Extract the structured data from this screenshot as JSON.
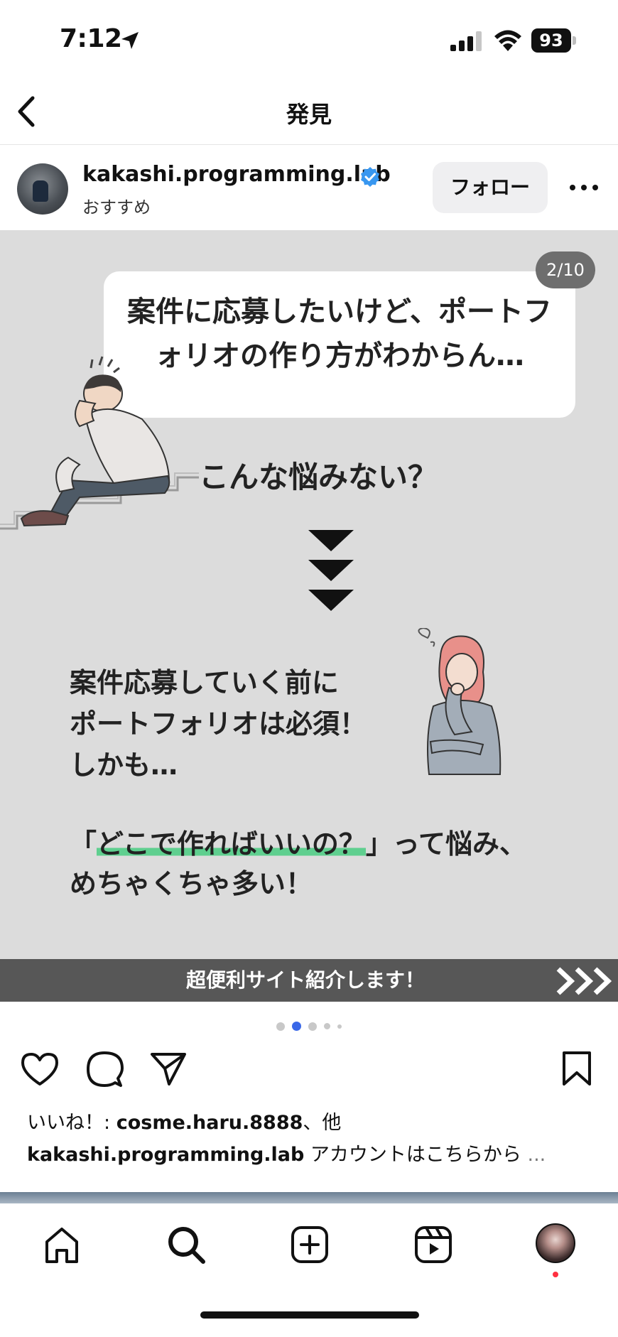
{
  "status_bar": {
    "time": "7:12",
    "battery": "93",
    "icons": [
      "location-arrow-icon",
      "signal-icon",
      "wifi-icon",
      "battery-icon"
    ]
  },
  "header": {
    "title": "発見",
    "back_icon": "chevron-left-icon"
  },
  "post": {
    "username": "kakashi.programming.lab",
    "subtitle": "おすすめ",
    "follow_label": "フォロー",
    "page_indicator": "2/10",
    "image": {
      "bubble_line1": "案件に応募したいけど、ポートフ",
      "bubble_line2": "ォリオの作り方がわからん…",
      "question": "こんな悩みない？",
      "body_line1": "案件応募していく前に",
      "body_line2": "ポートフォリオは必須！",
      "body_line3": "しかも…",
      "quote_open": "「",
      "quote_highlight": "どこで作ればいいの？",
      "quote_rest": "」って悩み、",
      "quote_line2": "めちゃくちゃ多い！",
      "banner": "超便利サイト紹介します！"
    },
    "carousel": {
      "total_dots": 5,
      "active_index": 1
    },
    "likes_prefix": "いいね！: ",
    "likes_user": "cosme.haru.8888",
    "likes_suffix": "、他",
    "caption_user": "kakashi.programming.lab",
    "caption_text": " アカウントはこちらから ",
    "caption_more": "..."
  },
  "tab_bar": {
    "items": [
      "home-icon",
      "search-icon",
      "create-icon",
      "reels-icon",
      "profile-avatar"
    ]
  },
  "colors": {
    "verified": "#3897f0",
    "highlight": "#5fcf8f",
    "active_dot": "#3a68e8",
    "notification": "#ff3040"
  }
}
